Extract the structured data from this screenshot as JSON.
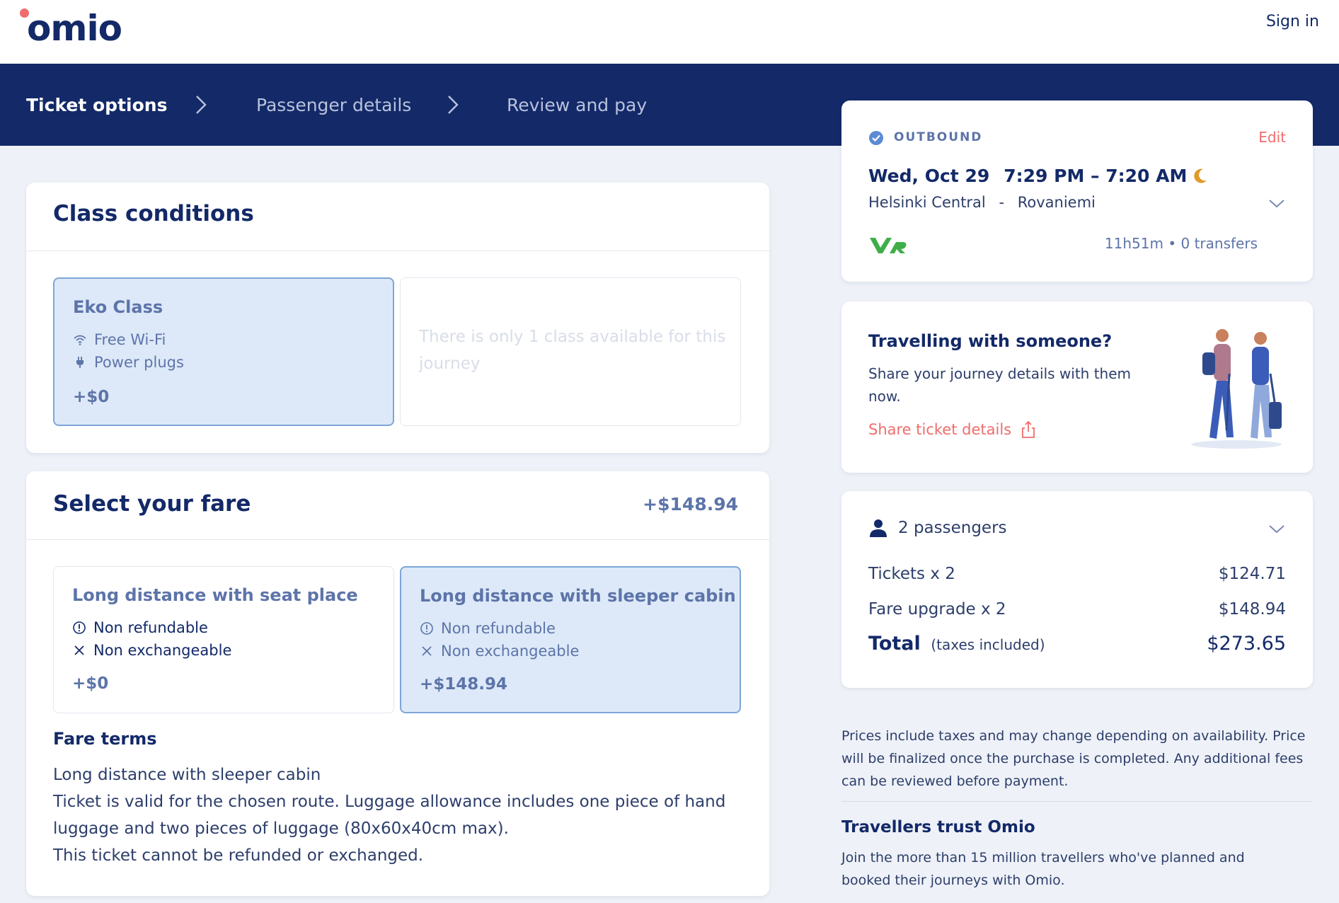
{
  "header": {
    "brand": "omio",
    "sign_in": "Sign in"
  },
  "steps": [
    {
      "label": "Ticket options",
      "active": true
    },
    {
      "label": "Passenger details",
      "active": false
    },
    {
      "label": "Review and pay",
      "active": false
    }
  ],
  "class_conditions": {
    "title": "Class conditions",
    "selected": {
      "name": "Eko Class",
      "features": [
        "Free Wi-Fi",
        "Power plugs"
      ],
      "price": "+$0"
    },
    "unavailable_text": "There is only 1 class available for this journey"
  },
  "fare": {
    "title": "Select your fare",
    "header_price": "+$148.94",
    "options": [
      {
        "name": "Long distance with seat place",
        "conditions": [
          "Non refundable",
          "Non exchangeable"
        ],
        "price": "+$0",
        "selected": false
      },
      {
        "name": "Long distance with sleeper cabin",
        "conditions": [
          "Non refundable",
          "Non exchangeable"
        ],
        "price": "+$148.94",
        "selected": true
      }
    ],
    "terms_title": "Fare terms",
    "terms": [
      "Long distance with sleeper cabin",
      "Ticket is valid for the chosen route. Luggage allowance includes one piece of hand luggage and two pieces of luggage (80x60x40cm max).",
      "This ticket cannot be refunded or exchanged."
    ]
  },
  "outbound": {
    "label": "OUTBOUND",
    "edit": "Edit",
    "date": "Wed, Oct 29",
    "times": "7:29 PM – 7:20 AM",
    "from": "Helsinki Central",
    "separator": "-",
    "to": "Rovaniemi",
    "duration": "11h51m",
    "dot": "•",
    "transfers": "0 transfers"
  },
  "share": {
    "title": "Travelling with someone?",
    "body": "Share your journey details with them now.",
    "link": "Share ticket details"
  },
  "summary": {
    "passengers": "2 passengers",
    "rows": [
      {
        "label": "Tickets x 2",
        "value": "$124.71"
      },
      {
        "label": "Fare upgrade x 2",
        "value": "$148.94"
      }
    ],
    "total_label": "Total",
    "total_note": "(taxes included)",
    "total_value": "$273.65"
  },
  "info": {
    "prices_note": "Prices include taxes and may change depending on availability. Price will be finalized once the purchase is completed. Any additional fees can be reviewed before payment.",
    "trust_title": "Travellers trust Omio",
    "trust_body": "Join the more than 15 million travellers who've planned and booked their journeys with Omio."
  },
  "colors": {
    "navy": "#132968",
    "accent_red": "#f06d6d",
    "muted_blue": "#5d74a9",
    "selected_bg": "#dde9f8",
    "vr_green": "#3fae49",
    "moon": "#e09a2c"
  },
  "icons": [
    "wifi-icon",
    "plug-icon",
    "info-circle-icon",
    "x-icon",
    "check-circle-icon",
    "moon-icon",
    "chevron-down-icon",
    "share-icon",
    "person-icon",
    "chevron-right-icon"
  ]
}
